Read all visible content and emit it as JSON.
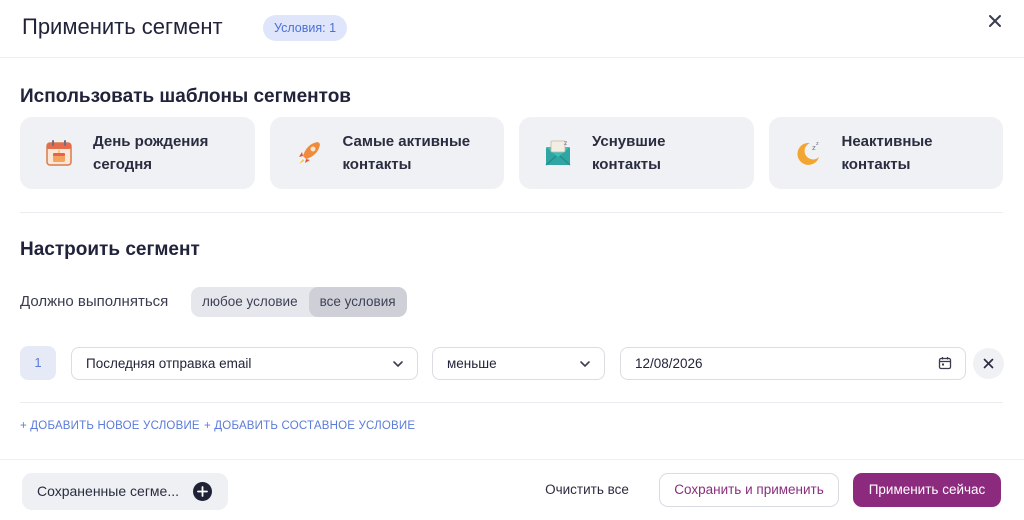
{
  "header": {
    "title": "Применить сегмент",
    "badge": "Условия: 1"
  },
  "templates": {
    "title": "Использовать шаблоны сегментов",
    "items": [
      {
        "label": "День рождения\nсегодня",
        "icon": "calendar-cake-icon"
      },
      {
        "label": "Самые активные\nконтакты",
        "icon": "rocket-icon"
      },
      {
        "label": "Уснувшие\nконтакты",
        "icon": "sleeping-envelope-icon"
      },
      {
        "label": "Неактивные\nконтакты",
        "icon": "moon-icon"
      }
    ]
  },
  "configure": {
    "title": "Настроить сегмент",
    "must_label": "Должно выполняться",
    "match_options": [
      "любое условие",
      "все условия"
    ],
    "match_selected": "все условия"
  },
  "condition": {
    "number": "1",
    "field": "Последняя отправка email",
    "operator": "меньше",
    "value": "12/08/2026"
  },
  "links": {
    "add_condition": "+ ДОБАВИТЬ НОВОЕ УСЛОВИЕ",
    "add_compound": "+ ДОБАВИТЬ СОСТАВНОЕ УСЛОВИЕ"
  },
  "footer": {
    "saved_segments": "Сохраненные сегме...",
    "clear_all": "Очистить все",
    "save_apply": "Сохранить и применить",
    "apply_now": "Применить сейчас"
  },
  "colors": {
    "accent": "#8c2a7e",
    "link": "#5a7bd9",
    "badge_bg": "#dfe6fb"
  }
}
